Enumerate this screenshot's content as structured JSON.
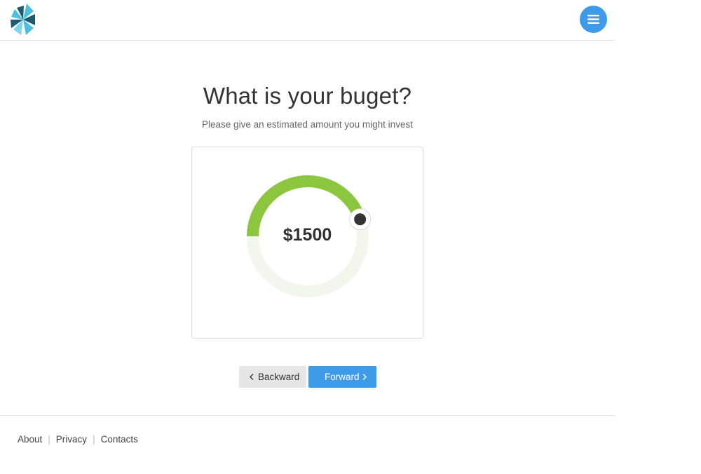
{
  "header": {
    "logo": {
      "icon": "pinwheel-logo",
      "colors": [
        "#4bc0dc",
        "#1e5a72",
        "#80d4ec"
      ]
    },
    "menu": {
      "icon": "hamburger-menu-icon",
      "color": "#3d9bea"
    }
  },
  "main": {
    "title": "What is your buget?",
    "subtitle": "Please give an estimated amount you might invest",
    "budget": {
      "value_text": "$1500",
      "dial_fraction": 0.45,
      "track_color": "#f2f6ec",
      "fill_color": "#8cc63f",
      "knob_color": "#333333"
    }
  },
  "buttons": {
    "back": {
      "label": "Backward",
      "icon": "chevron-left-icon"
    },
    "forward": {
      "label": "Forward",
      "icon": "chevron-right-icon",
      "color": "#3d9bea"
    }
  },
  "footer": {
    "links": [
      "About",
      "Privacy",
      "Contacts"
    ],
    "separator": "|"
  }
}
